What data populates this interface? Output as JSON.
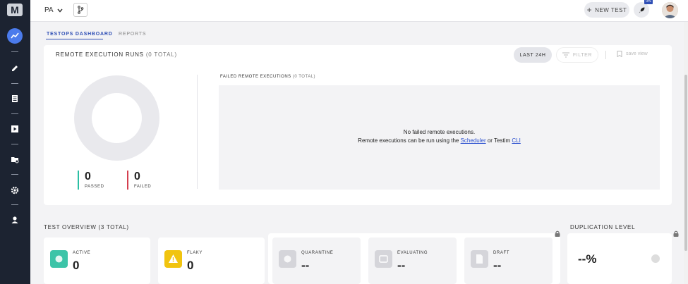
{
  "colors": {
    "sidebar_bg": "#1c2331",
    "accent": "#2f4fb5",
    "nav_active": "#4b7bec",
    "passed": "#2bbfa4",
    "failed": "#d43f4f",
    "active_icon": "#3cc4a8",
    "flaky_icon": "#f1c40f"
  },
  "sidebar": {
    "logo": "M",
    "items": [
      {
        "icon": "dashboard-icon",
        "active": true
      },
      {
        "icon": "edit-icon",
        "active": false
      },
      {
        "icon": "list-icon",
        "active": false
      },
      {
        "icon": "play-icon",
        "active": false
      },
      {
        "icon": "folder-settings-icon",
        "active": false
      },
      {
        "icon": "gear-icon",
        "active": false
      },
      {
        "icon": "user-icon",
        "active": false
      }
    ]
  },
  "topbar": {
    "project": "PA",
    "new_test_label": "NEW TEST",
    "rocket_badge": "0%"
  },
  "tabs": [
    {
      "label": "TESTOPS DASHBOARD",
      "active": true
    },
    {
      "label": "REPORTS",
      "active": false
    }
  ],
  "runs": {
    "title": "REMOTE EXECUTION RUNS",
    "count": "(0 TOTAL)",
    "last24_label": "LAST 24H",
    "filter_label": "FILTER",
    "save_view_label": "save view",
    "passed_value": "0",
    "passed_label": "PASSED",
    "failed_value": "0",
    "failed_label": "FAILED",
    "failed_title": "FAILED REMOTE EXECUTIONS",
    "failed_count": "(0 TOTAL)",
    "empty_line1": "No failed remote executions.",
    "empty_line2_prefix": "Remote executions can be run using the ",
    "scheduler_link": "Scheduler",
    "empty_line2_mid": " or Testim ",
    "cli_link": "CLI"
  },
  "overview": {
    "title": "TEST OVERVIEW",
    "count": "(3 TOTAL)",
    "cards": [
      {
        "label": "ACTIVE",
        "value": "0",
        "icon": "active-icon"
      },
      {
        "label": "FLAKY",
        "value": "0",
        "icon": "flaky-warning-icon"
      },
      {
        "label": "QUARANTINE",
        "value": "--",
        "icon": "quarantine-icon"
      },
      {
        "label": "EVALUATING",
        "value": "--",
        "icon": "evaluating-icon"
      },
      {
        "label": "DRAFT",
        "value": "--",
        "icon": "draft-icon"
      }
    ]
  },
  "duplication": {
    "title": "DUPLICATION LEVEL",
    "value": "--%"
  }
}
